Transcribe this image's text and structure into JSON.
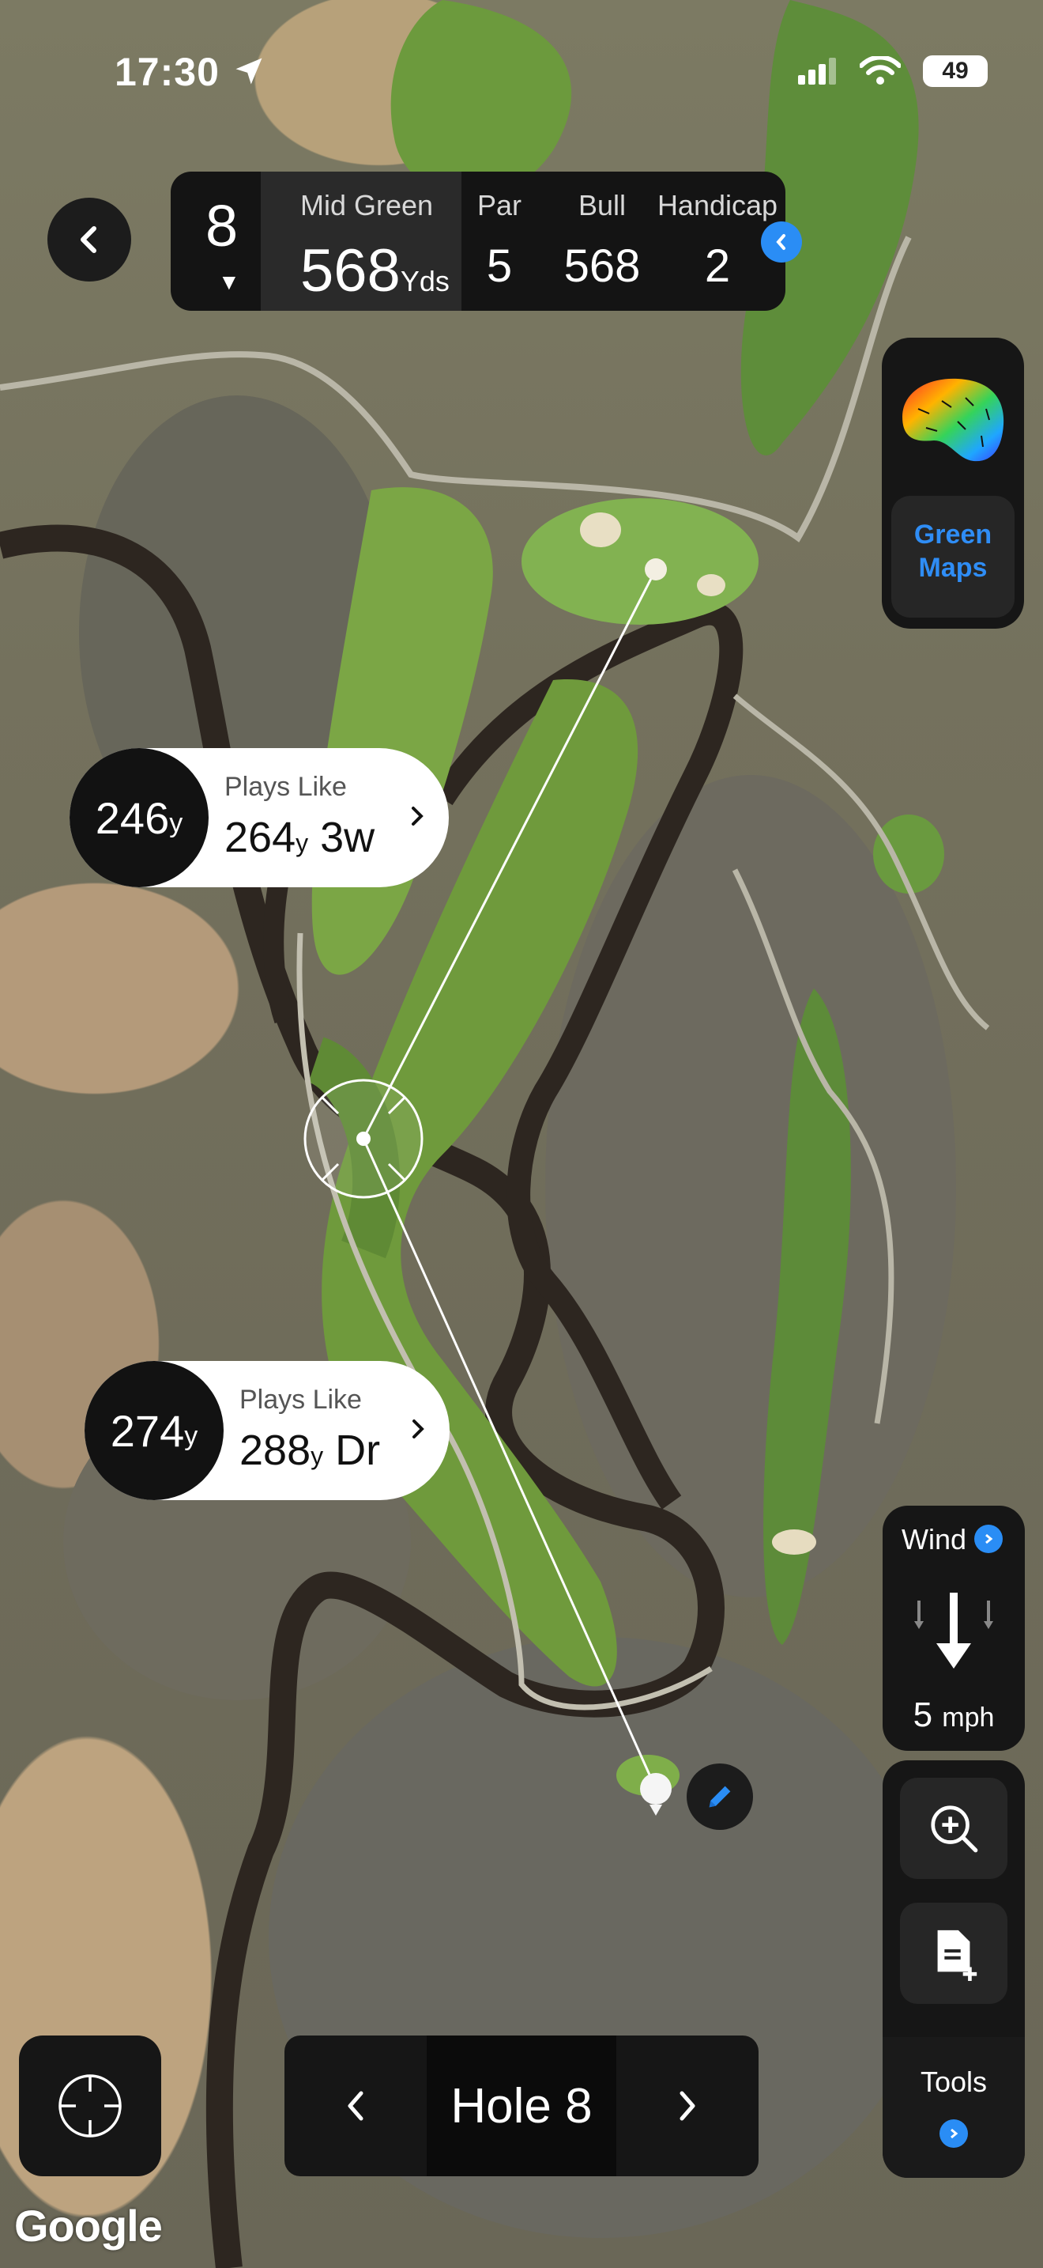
{
  "status_bar": {
    "time": "17:30",
    "battery": "49"
  },
  "header": {
    "hole_number": "8",
    "mid_green_label": "Mid Green",
    "mid_green_value": "568",
    "mid_green_unit": "Yds",
    "par_label": "Par",
    "par_value": "5",
    "bull_label": "Bull",
    "bull_value": "568",
    "handicap_label": "Handicap",
    "handicap_value": "2"
  },
  "green_maps": {
    "line1": "Green",
    "line2": "Maps"
  },
  "shots": [
    {
      "distance": "246",
      "unit": "y",
      "plays_like_label": "Plays Like",
      "plays_like": "264",
      "plays_unit": "y",
      "club": "3w"
    },
    {
      "distance": "274",
      "unit": "y",
      "plays_like_label": "Plays Like",
      "plays_like": "288",
      "plays_unit": "y",
      "club": "Dr"
    }
  ],
  "wind": {
    "label": "Wind",
    "speed": "5",
    "unit": "mph"
  },
  "tools": {
    "label": "Tools"
  },
  "hole_nav": {
    "label": "Hole 8"
  },
  "map": {
    "attribution": "Google"
  },
  "colors": {
    "accent": "#2a8df5",
    "panel": "#161616"
  },
  "icons": [
    "back-chevron-icon",
    "location-arrow-icon",
    "signal-icon",
    "wifi-icon",
    "battery-icon",
    "info-dot-icon",
    "green-heatmap-icon",
    "edit-pencil-icon",
    "wind-arrow-icon",
    "zoom-in-icon",
    "add-note-icon",
    "crosshair-icon",
    "chevron-left-icon",
    "chevron-right-icon"
  ]
}
